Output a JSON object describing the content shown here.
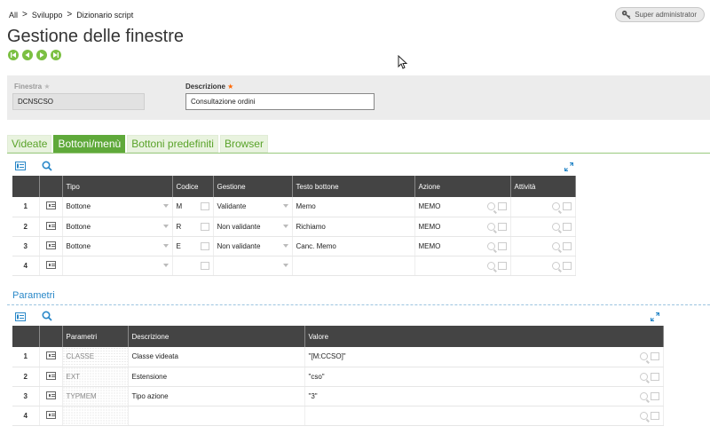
{
  "breadcrumb": [
    "All",
    "Sviluppo",
    "Dizionario script"
  ],
  "user": {
    "label": "Super administrator"
  },
  "page_title": "Gestione delle finestre",
  "fields": {
    "finestra": {
      "label": "Finestra",
      "value": "DCNSCSO"
    },
    "descrizione": {
      "label": "Descrizione",
      "value": "Consultazione ordini"
    }
  },
  "tabs": [
    {
      "label": "Videate",
      "active": false
    },
    {
      "label": "Bottoni/menù",
      "active": true
    },
    {
      "label": "Bottoni predefiniti",
      "active": false
    },
    {
      "label": "Browser",
      "active": false
    }
  ],
  "grid1": {
    "headers": [
      "Tipo",
      "Codice",
      "Gestione",
      "Testo bottone",
      "Azione",
      "Attività"
    ],
    "rows": [
      {
        "num": "1",
        "tipo": "Bottone",
        "codice": "M",
        "gestione": "Validante",
        "testo": "Memo",
        "azione": "MEMO",
        "attivita": ""
      },
      {
        "num": "2",
        "tipo": "Bottone",
        "codice": "R",
        "gestione": "Non validante",
        "testo": "Richiamo",
        "azione": "MEMO",
        "attivita": ""
      },
      {
        "num": "3",
        "tipo": "Bottone",
        "codice": "E",
        "gestione": "Non validante",
        "testo": "Canc. Memo",
        "azione": "MEMO",
        "attivita": ""
      },
      {
        "num": "4",
        "tipo": "",
        "codice": "",
        "gestione": "",
        "testo": "",
        "azione": "",
        "attivita": ""
      }
    ]
  },
  "section": {
    "title": "Parametri"
  },
  "grid2": {
    "headers": [
      "Parametri",
      "Descrizione",
      "Valore"
    ],
    "rows": [
      {
        "num": "1",
        "parametri": "CLASSE",
        "descrizione": "Classe videata",
        "valore": "\"[M:CCSO]\""
      },
      {
        "num": "2",
        "parametri": "EXT",
        "descrizione": "Estensione",
        "valore": "\"cso\""
      },
      {
        "num": "3",
        "parametri": "TYPMEM",
        "descrizione": "Tipo azione",
        "valore": "\"3\""
      },
      {
        "num": "4",
        "parametri": "",
        "descrizione": "",
        "valore": ""
      }
    ]
  },
  "icons": [
    "key-icon",
    "first-record-icon",
    "previous-record-icon",
    "next-record-icon",
    "last-record-icon",
    "row-detail-icon",
    "search-icon",
    "expand-icon",
    "lookup-icon",
    "calculator-icon",
    "dropdown-arrow-icon"
  ],
  "colors": {
    "accent_green": "#5fa93a",
    "nav_green": "#7cc043",
    "section_blue": "#2a88c8",
    "required_star": "#ff6600",
    "header_dark": "#444444"
  }
}
